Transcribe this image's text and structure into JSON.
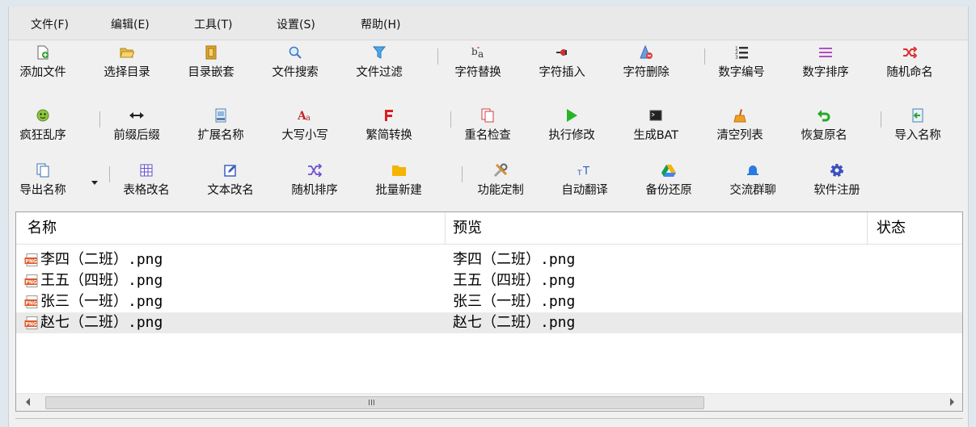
{
  "menu": [
    "文件(F)",
    "编辑(E)",
    "工具(T)",
    "设置(S)",
    "帮助(H)"
  ],
  "toolbar": {
    "row1": [
      {
        "label": "添加文件",
        "icon": "add-file-icon"
      },
      {
        "label": "选择目录",
        "icon": "folder-open-icon"
      },
      {
        "label": "目录嵌套",
        "icon": "nested-folder-icon"
      },
      {
        "label": "文件搜索",
        "icon": "search-icon"
      },
      {
        "label": "文件过滤",
        "icon": "filter-icon"
      },
      {
        "label": "字符替换",
        "icon": "replace-chars-icon"
      },
      {
        "label": "字符插入",
        "icon": "insert-chars-icon"
      },
      {
        "label": "字符删除",
        "icon": "delete-chars-icon"
      },
      {
        "label": "数字编号",
        "icon": "numbered-list-icon"
      },
      {
        "label": "数字排序",
        "icon": "sort-lines-icon"
      },
      {
        "label": "随机命名",
        "icon": "shuffle-icon"
      }
    ],
    "row2": [
      {
        "label": "疯狂乱序",
        "icon": "crazy-face-icon"
      },
      {
        "label": "前缀后缀",
        "icon": "left-right-arrows-icon"
      },
      {
        "label": "扩展名称",
        "icon": "extension-file-icon"
      },
      {
        "label": "大写小写",
        "icon": "letter-case-icon"
      },
      {
        "label": "繁简转换",
        "icon": "traditional-simplified-icon"
      },
      {
        "label": "重名检查",
        "icon": "duplicate-check-icon"
      },
      {
        "label": "执行修改",
        "icon": "play-icon"
      },
      {
        "label": "生成BAT",
        "icon": "terminal-icon"
      },
      {
        "label": "清空列表",
        "icon": "broom-icon"
      },
      {
        "label": "恢复原名",
        "icon": "undo-icon"
      },
      {
        "label": "导入名称",
        "icon": "import-icon"
      }
    ],
    "row3": [
      {
        "label": "导出名称",
        "icon": "export-icon"
      },
      {
        "label": "表格改名",
        "icon": "table-icon"
      },
      {
        "label": "文本改名",
        "icon": "edit-text-icon"
      },
      {
        "label": "随机排序",
        "icon": "random-sort-icon"
      },
      {
        "label": "批量新建",
        "icon": "new-folder-icon"
      },
      {
        "label": "功能定制",
        "icon": "tools-icon"
      },
      {
        "label": "自动翻译",
        "icon": "translate-icon"
      },
      {
        "label": "备份还原",
        "icon": "backup-drive-icon"
      },
      {
        "label": "交流群聊",
        "icon": "chat-bell-icon"
      },
      {
        "label": "软件注册",
        "icon": "gear-icon"
      }
    ]
  },
  "list": {
    "columns": [
      "名称",
      "预览",
      "状态"
    ],
    "rows": [
      {
        "name": "李四（二班）.png",
        "preview": "李四（二班）.png",
        "status": "",
        "selected": false
      },
      {
        "name": "王五（四班）.png",
        "preview": "王五（四班）.png",
        "status": "",
        "selected": false
      },
      {
        "name": "张三（一班）.png",
        "preview": "张三（一班）.png",
        "status": "",
        "selected": false
      },
      {
        "name": "赵七（二班）.png",
        "preview": "赵七（二班）.png",
        "status": "",
        "selected": true
      }
    ]
  },
  "scrollbar": {
    "grip": "III"
  },
  "colors": {
    "selected_row": "#eaeaea",
    "border": "#9aa3ad"
  }
}
